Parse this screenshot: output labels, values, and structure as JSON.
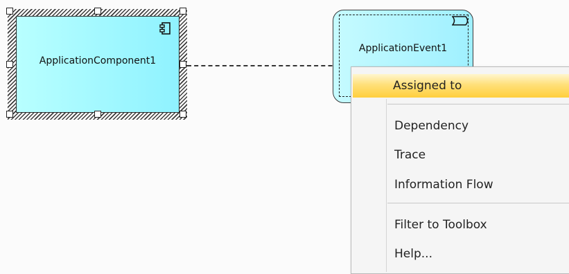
{
  "diagram": {
    "component": {
      "label": "ApplicationComponent1",
      "icon": "component-icon"
    },
    "event": {
      "label": "ApplicationEvent1",
      "icon": "event-icon"
    },
    "connector": {
      "style": "dashed"
    }
  },
  "context_menu": {
    "items": [
      {
        "label": "Assigned to",
        "highlighted": true
      },
      {
        "label": "Dependency"
      },
      {
        "label": "Trace"
      },
      {
        "label": "Information Flow"
      },
      {
        "label": "Filter to Toolbox"
      },
      {
        "label": "Help..."
      }
    ]
  },
  "colors": {
    "component_fill": "#8ff2ff",
    "event_fill": "#9ff0ff",
    "menu_highlight": "#ffcf3d",
    "menu_background": "#f5f5f5"
  }
}
